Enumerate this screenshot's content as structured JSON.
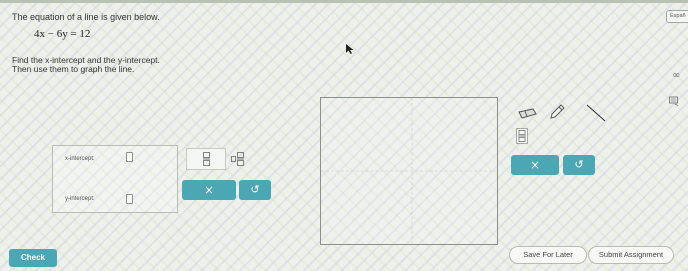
{
  "header": {
    "espanol_label": "Españ"
  },
  "question": {
    "prompt": "The equation of a line is given below.",
    "equation": "4x − 6y = 12",
    "instruction_line1": "Find the x-intercept and the y-intercept.",
    "instruction_line2": "Then use them to graph the line."
  },
  "answer": {
    "x_intercept_label": "x-intercept:",
    "y_intercept_label": "y-intercept:",
    "x_intercept_value": "",
    "y_intercept_value": "",
    "clear_symbol": "×",
    "undo_symbol": "↺"
  },
  "side_icons": {
    "infinity": "∞"
  },
  "graph_tools": {
    "clear_symbol": "×",
    "undo_symbol": "↺"
  },
  "footer": {
    "check_label": "Check",
    "save_label": "Save For Later",
    "submit_label": "Submit Assignment"
  },
  "colors": {
    "accent": "#4ba7b3",
    "background": "#eef0ea"
  },
  "icons": [
    "cursor-icon",
    "keyboard-icon",
    "fraction-icon",
    "mixed-number-icon",
    "eraser-icon",
    "pencil-icon",
    "line-tool-icon",
    "fraction-tool-icon"
  ]
}
